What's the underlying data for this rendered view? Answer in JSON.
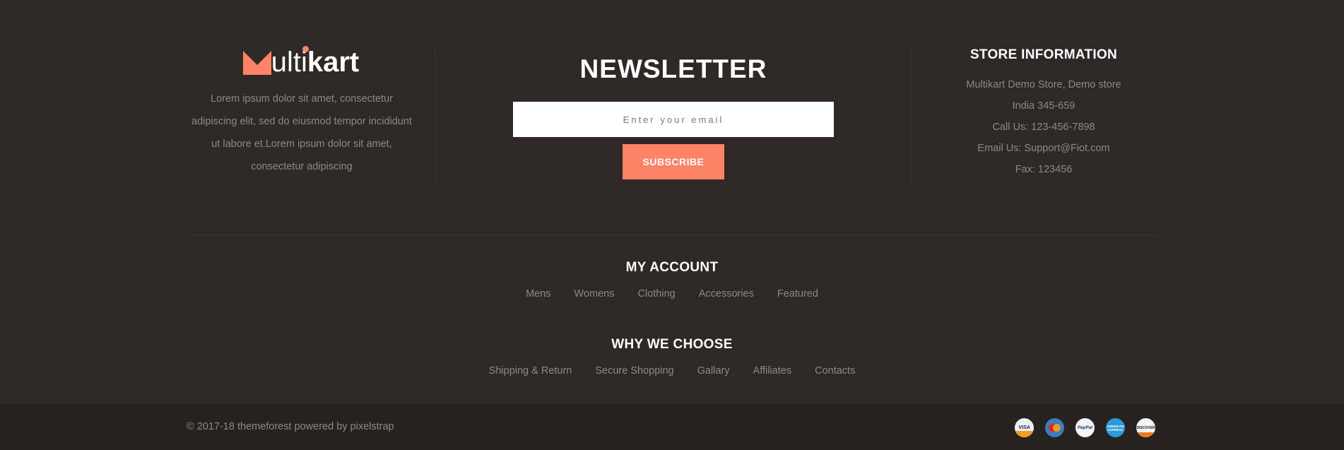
{
  "brand": {
    "logo_letter_m_color": "#ff8367",
    "logo_text_prefix": "ult",
    "logo_text_i": "i",
    "logo_text_suffix": "kart",
    "accent_color": "#ff8367"
  },
  "about": {
    "text": "Lorem ipsum dolor sit amet, consectetur adipiscing elit, sed do eiusmod tempor incididunt ut labore et.Lorem ipsum dolor sit amet, consectetur adipiscing"
  },
  "newsletter": {
    "title": "NEWSLETTER",
    "placeholder": "Enter your email",
    "button_label": "SUBSCRIBE"
  },
  "store_info": {
    "title": "STORE INFORMATION",
    "lines": [
      "Multikart Demo Store, Demo store",
      "India 345-659",
      "Call Us: 123-456-7898",
      "Email Us: Support@Fiot.com",
      "Fax: 123456"
    ]
  },
  "my_account": {
    "title": "MY ACCOUNT",
    "links": [
      "Mens",
      "Womens",
      "Clothing",
      "Accessories",
      "Featured"
    ]
  },
  "why_we_choose": {
    "title": "WHY WE CHOOSE",
    "links": [
      "Shipping & Return",
      "Secure Shopping",
      "Gallary",
      "Affiliates",
      "Contacts"
    ]
  },
  "sub_footer": {
    "copyright": "© 2017-18 themeforest powered by pixelstrap",
    "payments": [
      {
        "icon": "visa-icon",
        "label": "VISA"
      },
      {
        "icon": "mastercard-icon",
        "label": ""
      },
      {
        "icon": "paypal-icon",
        "label": "PayPal"
      },
      {
        "icon": "american-express-icon",
        "label": "AMERICAN EXPRESS"
      },
      {
        "icon": "discover-icon",
        "label": "DISCOVER"
      }
    ]
  }
}
